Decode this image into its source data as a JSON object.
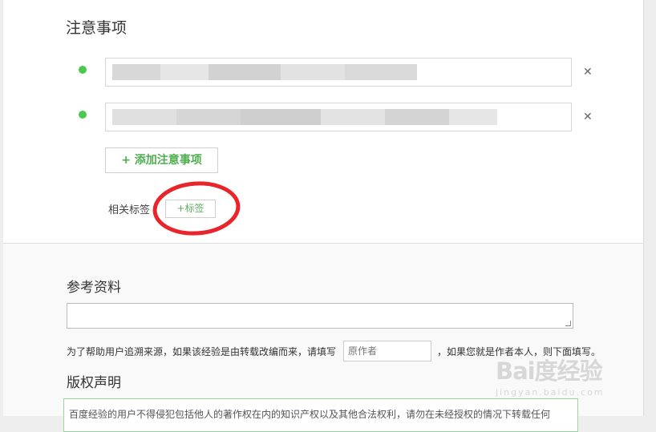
{
  "notes": {
    "title": "注意事项",
    "remove_symbol": "✕",
    "add_button": "+ 添加注意事项"
  },
  "tags": {
    "label": "相关标签",
    "add_tag_button": "+标签"
  },
  "references": {
    "title": "参考资料",
    "hint_before": "为了帮助用户追溯来源，如果该经验是由转载改编而来，请填写",
    "author_placeholder": "原作者",
    "hint_after": "，如果您就是作者本人，则下面填写。"
  },
  "copyright": {
    "title": "版权声明",
    "text": "百度经验的用户不得侵犯包括他人的著作权在内的知识产权以及其他合法权利，请勿在未经授权的情况下转载任何"
  },
  "watermark": {
    "logo": "Bai度经验",
    "url": "jingyan.baidu.com"
  },
  "colors": {
    "accent_green": "#4cc94c",
    "annotation_red": "#e8252a"
  },
  "icons": [
    "bullet-dot",
    "close-x"
  ]
}
